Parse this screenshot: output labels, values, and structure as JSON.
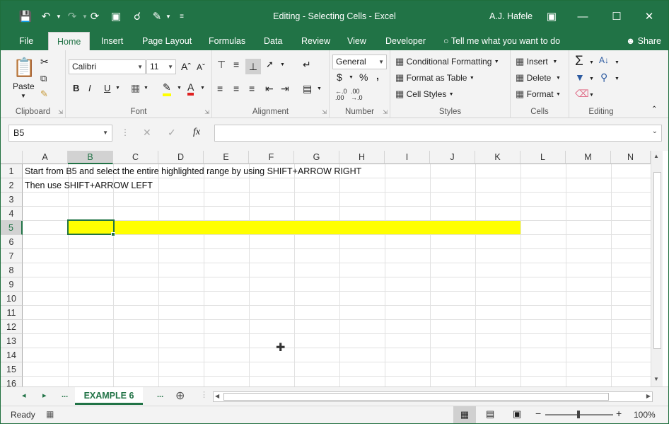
{
  "window": {
    "title": "Editing - Selecting Cells  -  Excel",
    "user": "A.J. Hafele"
  },
  "tabs": [
    "File",
    "Home",
    "Insert",
    "Page Layout",
    "Formulas",
    "Data",
    "Review",
    "View",
    "Developer"
  ],
  "active_tab": "Home",
  "tell_me": "Tell me what you want to do",
  "share": "Share",
  "ribbon": {
    "clipboard": {
      "label": "Clipboard",
      "paste": "Paste"
    },
    "font": {
      "label": "Font",
      "name": "Calibri",
      "size": "11",
      "bold": "B",
      "italic": "I",
      "underline": "U"
    },
    "alignment": {
      "label": "Alignment"
    },
    "number": {
      "label": "Number",
      "format": "General",
      "currency": "$",
      "percent": "%",
      "comma": ","
    },
    "styles": {
      "label": "Styles",
      "conditional": "Conditional Formatting",
      "format_table": "Format as Table",
      "cell_styles": "Cell Styles"
    },
    "cells": {
      "label": "Cells",
      "insert": "Insert",
      "delete": "Delete",
      "format": "Format"
    },
    "editing": {
      "label": "Editing"
    }
  },
  "formula_bar": {
    "name_box": "B5",
    "fx": "fx",
    "value": ""
  },
  "columns": [
    "A",
    "B",
    "C",
    "D",
    "E",
    "F",
    "G",
    "H",
    "I",
    "J",
    "K",
    "L",
    "M",
    "N"
  ],
  "rows": [
    "1",
    "2",
    "3",
    "4",
    "5",
    "6",
    "7",
    "8",
    "9",
    "10",
    "11",
    "12",
    "13",
    "14",
    "15",
    "16"
  ],
  "cells": {
    "A1": "Start from B5 and select the entire highlighted range by using SHIFT+ARROW RIGHT",
    "A2": "Then use SHIFT+ARROW LEFT"
  },
  "selected_cell": "B5",
  "highlight": {
    "range": "B5:K5",
    "color": "#ffff00"
  },
  "sheet_tab": "EXAMPLE 6",
  "sheet_nav": {
    "prev": "◂",
    "next": "▸",
    "more_left": "...",
    "more_right": "..."
  },
  "status": {
    "ready": "Ready",
    "zoom": "100%"
  },
  "colors": {
    "brand": "#217346",
    "highlight": "#ffff00"
  }
}
